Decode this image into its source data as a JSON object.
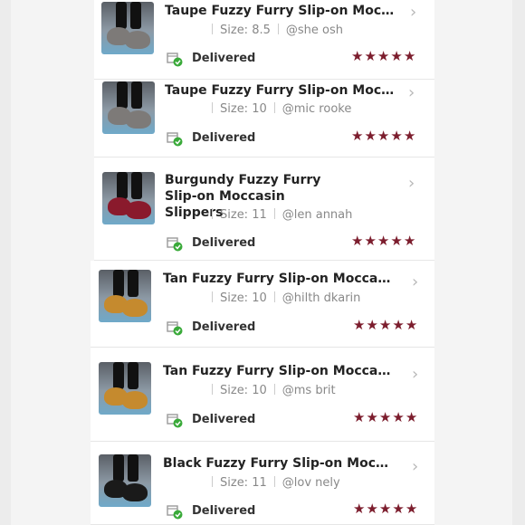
{
  "orders": [
    {
      "title": "Taupe Fuzzy Furry Slip-on Moccasin Slippers",
      "size": "Size: 8.5",
      "user": "@she     osh",
      "status": "Delivered",
      "rating": 5,
      "shoe_color": "#7d7a78"
    },
    {
      "title": "Taupe Fuzzy Furry Slip-on Moccasin Slippers",
      "size": "Size: 10",
      "user": "@mic     rooke",
      "status": "Delivered",
      "rating": 5,
      "shoe_color": "#7d7a78"
    },
    {
      "title": "Burgundy Fuzzy Furry Slip-on Moccasin Slippers",
      "size": "Size: 11",
      "user": "@len     annah",
      "status": "Delivered",
      "rating": 5,
      "shoe_color": "#8a1a2c"
    },
    {
      "title": "Tan Fuzzy Furry Slip-on Moccasin Slippers",
      "size": "Size: 10",
      "user": "@hilth     dkarin",
      "status": "Delivered",
      "rating": 5,
      "shoe_color": "#c58a2e"
    },
    {
      "title": "Tan Fuzzy Furry Slip-on Moccasin Slippers",
      "size": "Size: 10",
      "user": "@ms     brit",
      "status": "Delivered",
      "rating": 5,
      "shoe_color": "#c58a2e"
    },
    {
      "title": "Black Fuzzy Furry Slip-on Moccasin Slippers",
      "size": "Size: 11",
      "user": "@lov     nely",
      "status": "Delivered",
      "rating": 5,
      "shoe_color": "#1a1a1a"
    }
  ],
  "colors": {
    "star": "#7c1d2d",
    "check": "#3aaa3a"
  },
  "icons": {
    "chevron": "chevron-right-icon",
    "status": "package-delivered-icon",
    "star": "star-icon"
  }
}
